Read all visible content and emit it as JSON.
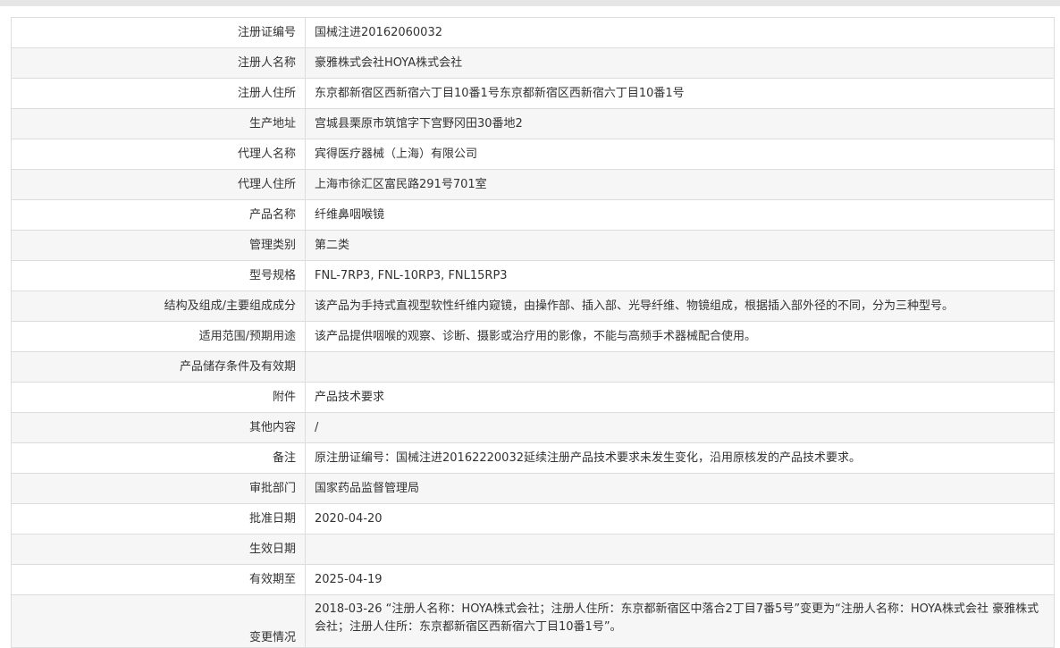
{
  "rows": [
    {
      "label": "注册证编号",
      "value": "国械注进20162060032"
    },
    {
      "label": "注册人名称",
      "value": "豪雅株式会社HOYA株式会社"
    },
    {
      "label": "注册人住所",
      "value": "东京都新宿区西新宿六丁目10番1号东京都新宿区西新宿六丁目10番1号"
    },
    {
      "label": "生产地址",
      "value": "宫城县栗原市筑馆字下宫野冈田30番地2"
    },
    {
      "label": "代理人名称",
      "value": "宾得医疗器械（上海）有限公司"
    },
    {
      "label": "代理人住所",
      "value": "上海市徐汇区富民路291号701室"
    },
    {
      "label": "产品名称",
      "value": "纤维鼻咽喉镜"
    },
    {
      "label": "管理类别",
      "value": "第二类"
    },
    {
      "label": "型号规格",
      "value": "FNL-7RP3, FNL-10RP3, FNL15RP3"
    },
    {
      "label": "结构及组成/主要组成成分",
      "value": "该产品为手持式直视型软性纤维内窥镜，由操作部、插入部、光导纤维、物镜组成，根据插入部外径的不同，分为三种型号。"
    },
    {
      "label": "适用范围/预期用途",
      "value": "该产品提供咽喉的观察、诊断、摄影或治疗用的影像，不能与高频手术器械配合使用。"
    },
    {
      "label": "产品储存条件及有效期",
      "value": ""
    },
    {
      "label": "附件",
      "value": "产品技术要求"
    },
    {
      "label": "其他内容",
      "value": "/"
    },
    {
      "label": "备注",
      "value": "原注册证编号：国械注进20162220032延续注册产品技术要求未发生变化，沿用原核发的产品技术要求。"
    },
    {
      "label": "审批部门",
      "value": "国家药品监督管理局"
    },
    {
      "label": "批准日期",
      "value": "2020-04-20"
    },
    {
      "label": "生效日期",
      "value": ""
    },
    {
      "label": "有效期至",
      "value": "2025-04-19"
    },
    {
      "label": "变更情况",
      "value": "2018-03-26 “注册人名称：HOYA株式会社；注册人住所：东京都新宿区中落合2丁目7番5号”变更为“注册人名称：HOYA株式会社 豪雅株式会社；注册人住所：东京都新宿区西新宿六丁目10番1号”。"
    }
  ]
}
